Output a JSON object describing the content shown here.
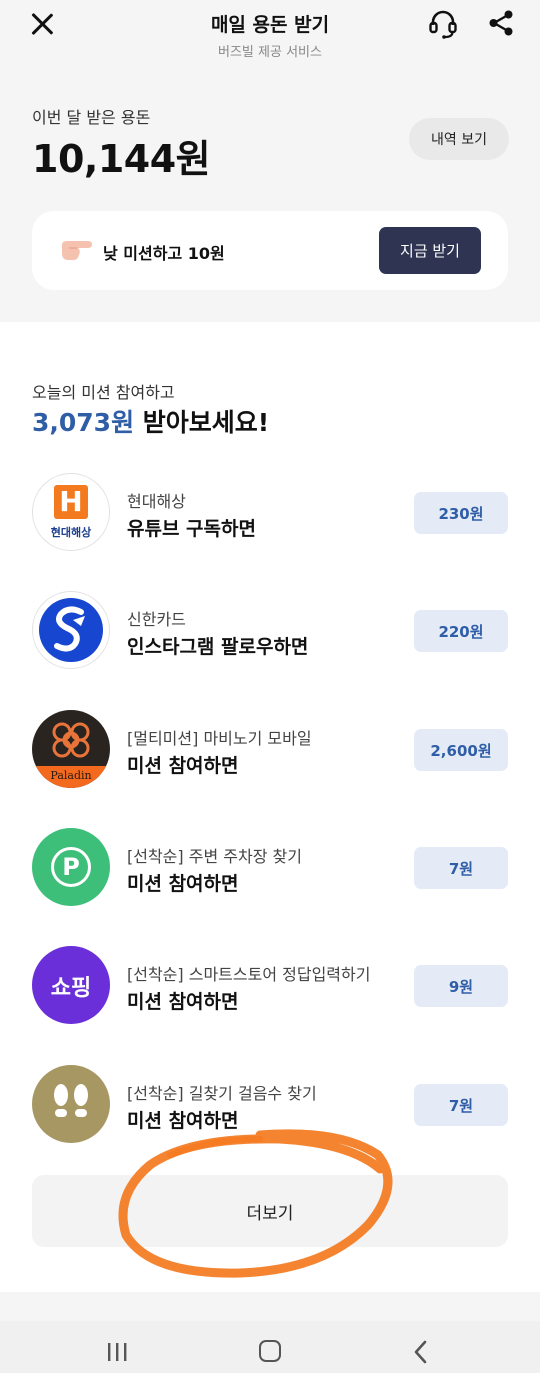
{
  "header": {
    "title": "매일 용돈 받기",
    "subtitle": "버즈빌 제공 서비스"
  },
  "balance": {
    "label": "이번 달 받은 용돈",
    "amount": "10,144원",
    "history_button": "내역 보기"
  },
  "promo": {
    "text": "낮 미션하고 10원",
    "button": "지금 받기"
  },
  "missions": {
    "intro": "오늘의 미션 참여하고",
    "headline_amount": "3,073원",
    "headline_suffix": " 받아보세요!",
    "items": [
      {
        "company": "현대해상",
        "action": "유튜브 구독하면",
        "reward": "230원",
        "logo_text": "현대해상",
        "logo_letter": "H"
      },
      {
        "company": "신한카드",
        "action": "인스타그램 팔로우하면",
        "reward": "220원"
      },
      {
        "company": "[멀티미션] 마비노기 모바일",
        "action": "미션 참여하면",
        "reward": "2,600원",
        "logo_text": "Paladin"
      },
      {
        "company": "[선착순] 주변 주차장 찾기",
        "action": "미션 참여하면",
        "reward": "7원",
        "logo_text": "P"
      },
      {
        "company": "[선착순] 스마트스토어 정답입력하기",
        "action": "미션 참여하면",
        "reward": "9원",
        "logo_text": "쇼핑"
      },
      {
        "company": "[선착순] 길찾기 걸음수 찾기",
        "action": "미션 참여하면",
        "reward": "7원"
      }
    ],
    "more_button": "더보기"
  },
  "colors": {
    "accent_blue": "#2f5ea7",
    "dark_button": "#2e3451",
    "reward_bg": "#e4ebf7",
    "annotation": "#f47a20"
  }
}
